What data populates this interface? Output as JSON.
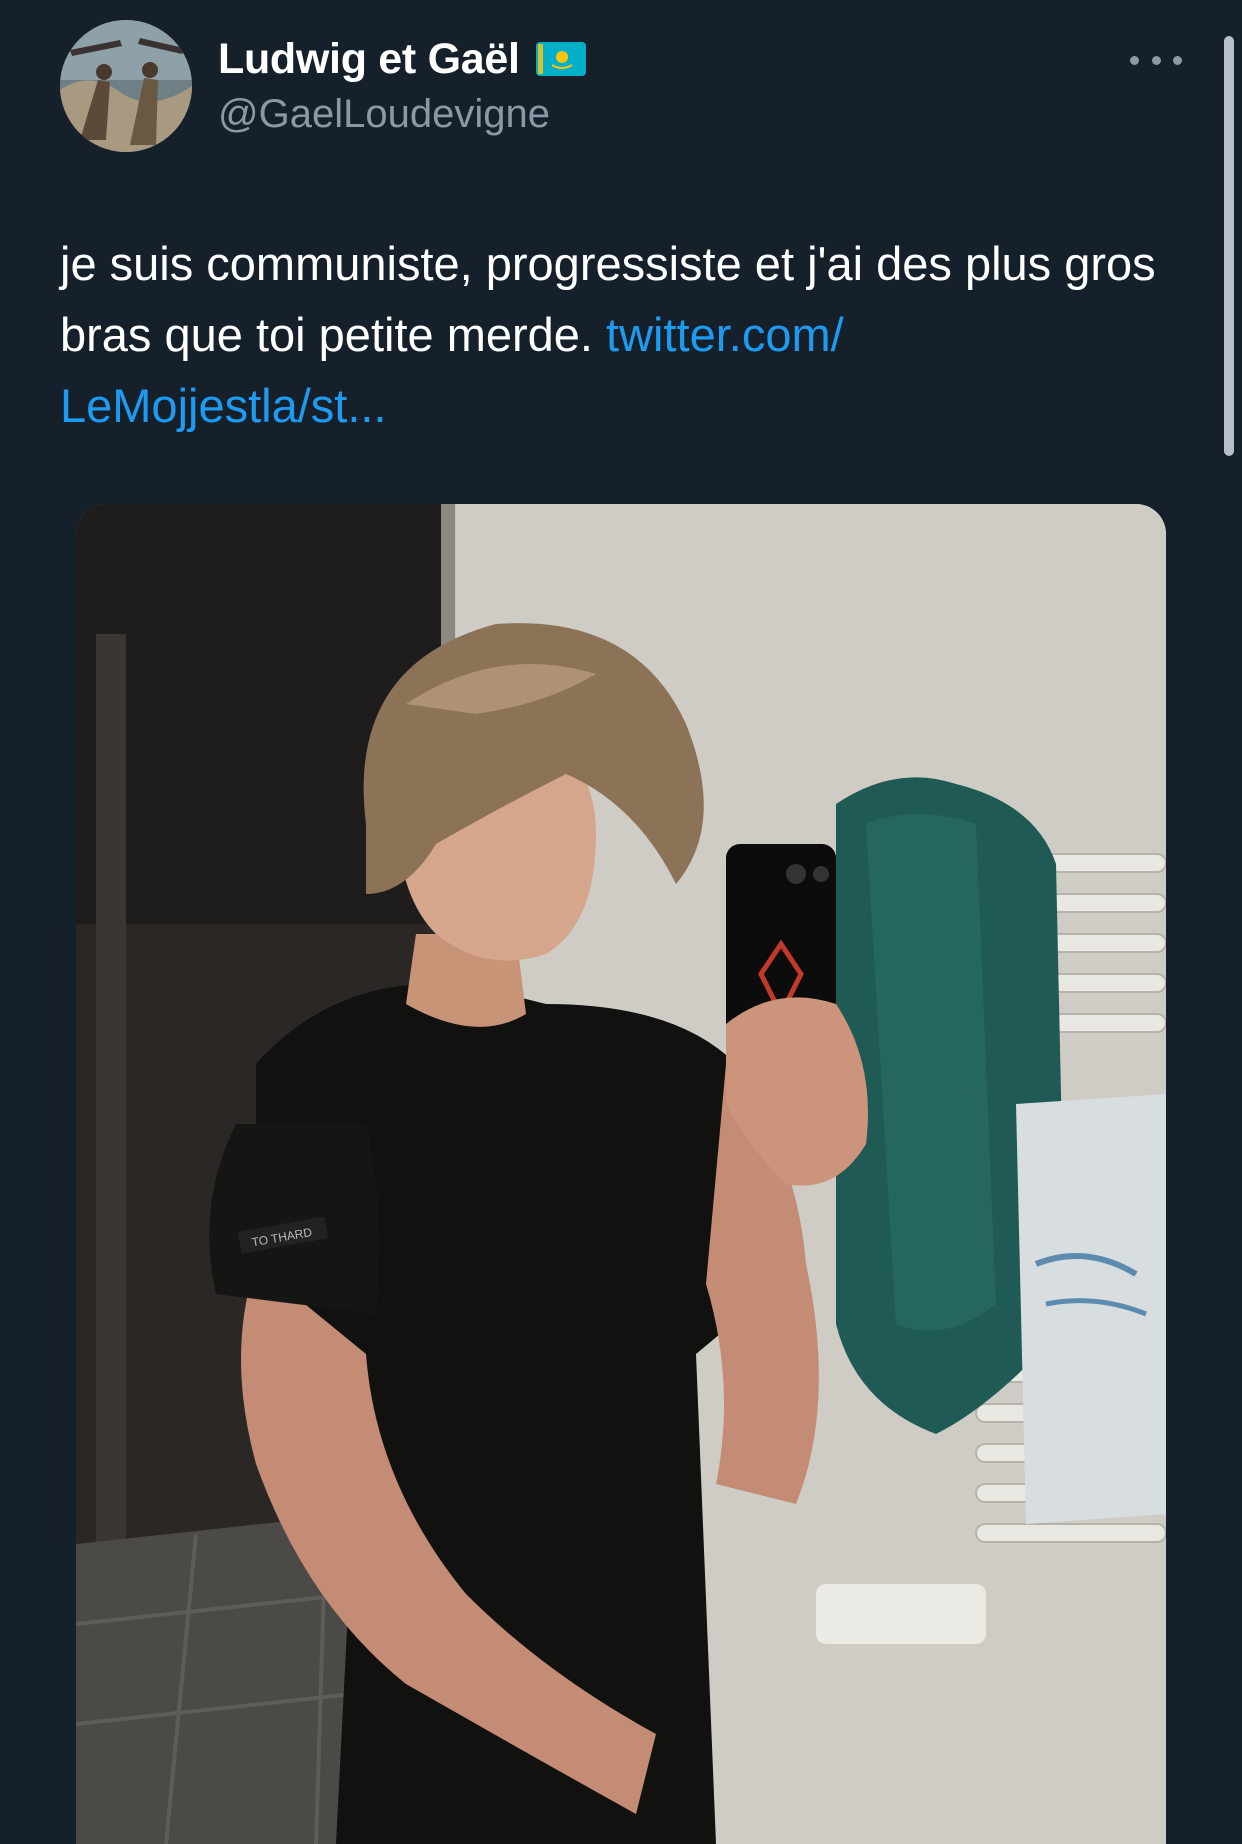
{
  "tweet": {
    "author": {
      "display_name": "Ludwig et Gaël",
      "handle": "@GaelLoudevigne",
      "flag_icon": "kazakhstan-flag-icon"
    },
    "text_main": "je suis communiste, progressiste et j'ai des plus gros bras que toi petite merde.",
    "link_line1": "twitter.com/",
    "link_line2": "LeMojjestla/st...",
    "media": {
      "kind": "photo",
      "patch_text": "TO THARD"
    },
    "more_icon": "more-horizontal-icon"
  },
  "colors": {
    "background": "#15202b",
    "text_primary": "#ffffff",
    "text_secondary": "#8b98a5",
    "link": "#1d9bf0",
    "flag_blue": "#00afca",
    "flag_yellow": "#fec50c"
  }
}
